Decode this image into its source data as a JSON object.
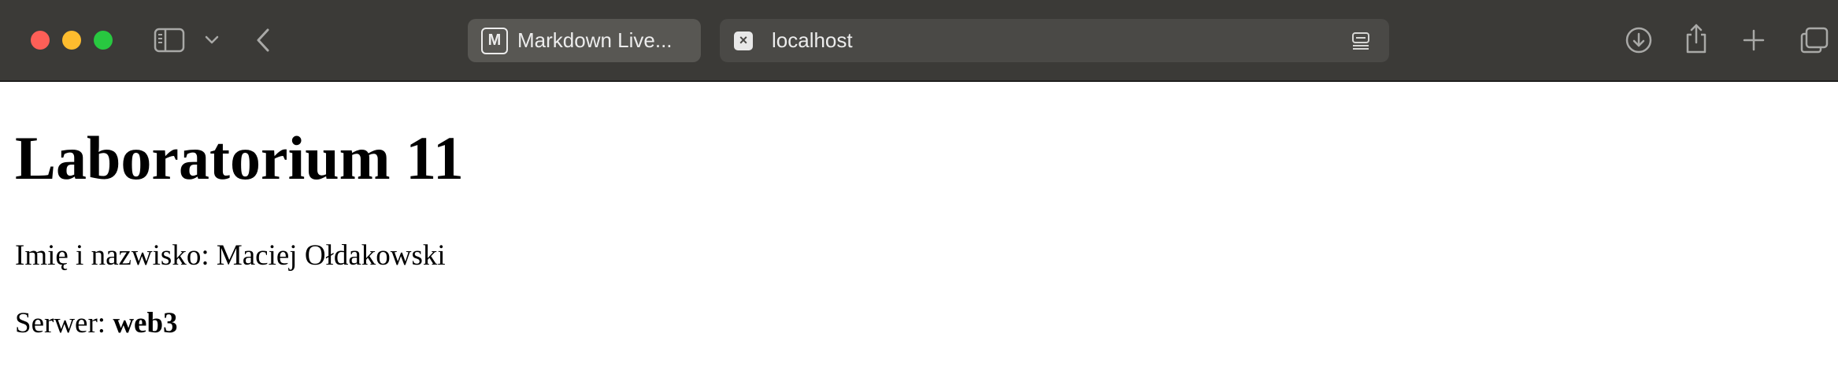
{
  "browser": {
    "tabs": [
      {
        "title": "Markdown Live...",
        "favicon": "markdown-m-icon",
        "active": true
      },
      {
        "title": "localhost",
        "favicon": "close-x-icon",
        "active": false
      }
    ],
    "icons": {
      "sidebar": "sidebar-icon",
      "chevron": "chevron-down-icon",
      "back": "back-arrow-icon",
      "reader": "reader-view-icon",
      "download": "download-icon",
      "share": "share-icon",
      "new_tab": "plus-icon",
      "tab_overview": "tab-overview-icon"
    },
    "colors": {
      "toolbar": "#3b3a37",
      "active_tab": "#585753",
      "inactive_tab": "#4a4946",
      "close": "#fe5f57",
      "minimize": "#febc2e",
      "maximize": "#28c840"
    }
  },
  "page": {
    "heading": "Laboratorium 11",
    "name_line": "Imię i nazwisko: Maciej Ołdakowski",
    "server_label": "Serwer: ",
    "server_value": "web3"
  }
}
